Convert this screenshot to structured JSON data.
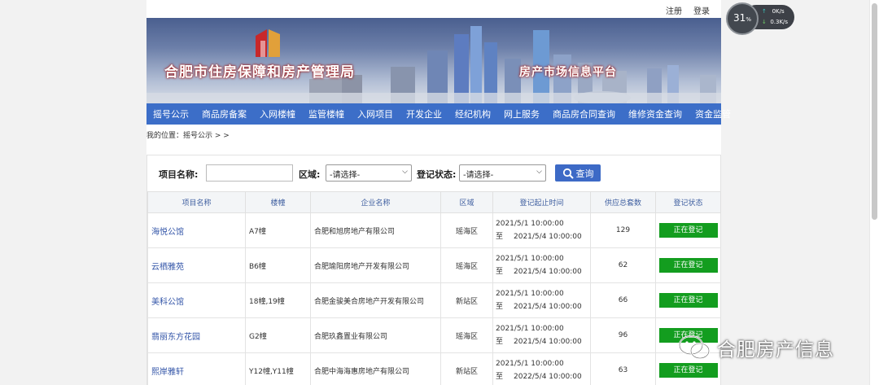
{
  "topbar": {
    "register": "注册",
    "login": "登录"
  },
  "banner": {
    "org_name": "合肥市住房保障和房产管理局",
    "platform_name": "房产市场信息平台"
  },
  "nav": [
    "摇号公示",
    "商品房备案",
    "入网楼幢",
    "监管楼幢",
    "入网项目",
    "开发企业",
    "经纪机构",
    "网上服务",
    "商品房合同查询",
    "维修资金查询",
    "资金监管"
  ],
  "breadcrumb": "我的位置：摇号公示 > >",
  "search": {
    "project_label": "项目名称:",
    "project_value": "",
    "region_label": "区域:",
    "region_selected": "-请选择-",
    "status_label": "登记状态:",
    "status_selected": "-请选择-",
    "search_button": "查询"
  },
  "table": {
    "headers": [
      "项目名称",
      "楼幢",
      "企业名称",
      "区域",
      "登记起止时间",
      "供应总套数",
      "登记状态"
    ],
    "time_to": "至",
    "rows": [
      {
        "project": "海悦公馆",
        "building": "A7幢",
        "company": "合肥和旭房地产有限公司",
        "region": "瑶海区",
        "start": "2021/5/1 10:00:00",
        "end": "2021/5/4 10:00:00",
        "units": "129",
        "status": "正在登记"
      },
      {
        "project": "云栖雅苑",
        "building": "B6幢",
        "company": "合肥瑜阳房地产开发有限公司",
        "region": "瑶海区",
        "start": "2021/5/1 10:00:00",
        "end": "2021/5/4 10:00:00",
        "units": "62",
        "status": "正在登记"
      },
      {
        "project": "美科公馆",
        "building": "18幢,19幢",
        "company": "合肥金骏美合房地产开发有限公司",
        "region": "新站区",
        "start": "2021/5/1 10:00:00",
        "end": "2021/5/4 10:00:00",
        "units": "66",
        "status": "正在登记"
      },
      {
        "project": "翡丽东方花园",
        "building": "G2幢",
        "company": "合肥玖鑫置业有限公司",
        "region": "瑶海区",
        "start": "2021/5/1 10:00:00",
        "end": "2021/5/4 10:00:00",
        "units": "96",
        "status": "正在登记"
      },
      {
        "project": "熙岸雅轩",
        "building": "Y12幢,Y11幢",
        "company": "合肥中海海惠房地产有限公司",
        "region": "新站区",
        "start": "2021/5/1 10:00:00",
        "end": "2022/5/4 10:00:00",
        "units": "63",
        "status": "正在登记"
      }
    ]
  },
  "speed_widget": {
    "percent": "31",
    "percent_unit": "%",
    "up": "0",
    "up_unit": "K/s",
    "down": "0.3",
    "down_unit": "K/s"
  },
  "watermark": "合肥房产信息",
  "colors": {
    "nav_blue": "#3c6ec8",
    "status_green": "#139d1f",
    "link_blue": "#3355a8"
  }
}
